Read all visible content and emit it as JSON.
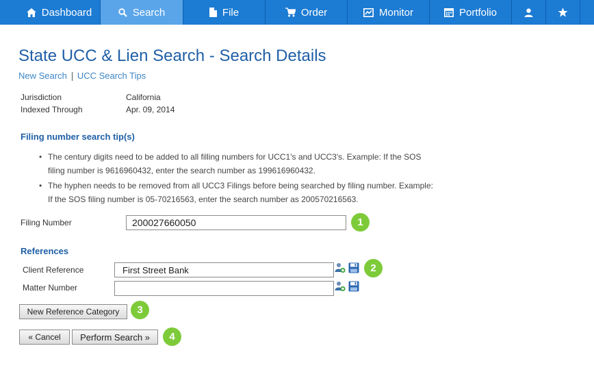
{
  "nav": {
    "items": [
      {
        "label": "Dashboard",
        "icon": "home-icon"
      },
      {
        "label": "Search",
        "icon": "search-icon",
        "active": true
      },
      {
        "label": "File",
        "icon": "file-icon"
      },
      {
        "label": "Order",
        "icon": "cart-icon"
      },
      {
        "label": "Monitor",
        "icon": "monitor-icon"
      },
      {
        "label": "Portfolio",
        "icon": "calendar-icon"
      },
      {
        "label": "",
        "icon": "user-icon"
      },
      {
        "label": "",
        "icon": "star-icon"
      }
    ],
    "colors": {
      "bar": "#1c7bd3",
      "active": "#5aa5ea"
    }
  },
  "page": {
    "title": "State UCC & Lien Search - Search Details",
    "links": {
      "new_search": "New Search",
      "tips": "UCC Search Tips"
    }
  },
  "details": {
    "jurisdiction_label": "Jurisdiction",
    "jurisdiction_value": "California",
    "indexed_label": "Indexed Through",
    "indexed_value": "Apr. 09, 2014"
  },
  "tips": {
    "heading": "Filing number search tip(s)",
    "items": [
      "The century digits need to be added to all filling numbers for UCC1's and UCC3's. Example: If the SOS filing number is 9616960432, enter the search number as 199616960432.",
      "The hyphen needs to be removed from all UCC3 Filings before being searched by filing number. Example: If the SOS filing number is 05-70216563, enter the search number as 200570216563."
    ]
  },
  "filing": {
    "label": "Filing Number",
    "value": "200027660050"
  },
  "references": {
    "heading": "References",
    "client_label": "Client Reference",
    "client_value": "First Street Bank",
    "matter_label": "Matter Number",
    "matter_value": ""
  },
  "buttons": {
    "new_category": "New Reference Category",
    "cancel": "« Cancel",
    "perform": "Perform Search »"
  },
  "badges": [
    "1",
    "2",
    "3",
    "4"
  ],
  "accent_color": "#7ecb3a"
}
